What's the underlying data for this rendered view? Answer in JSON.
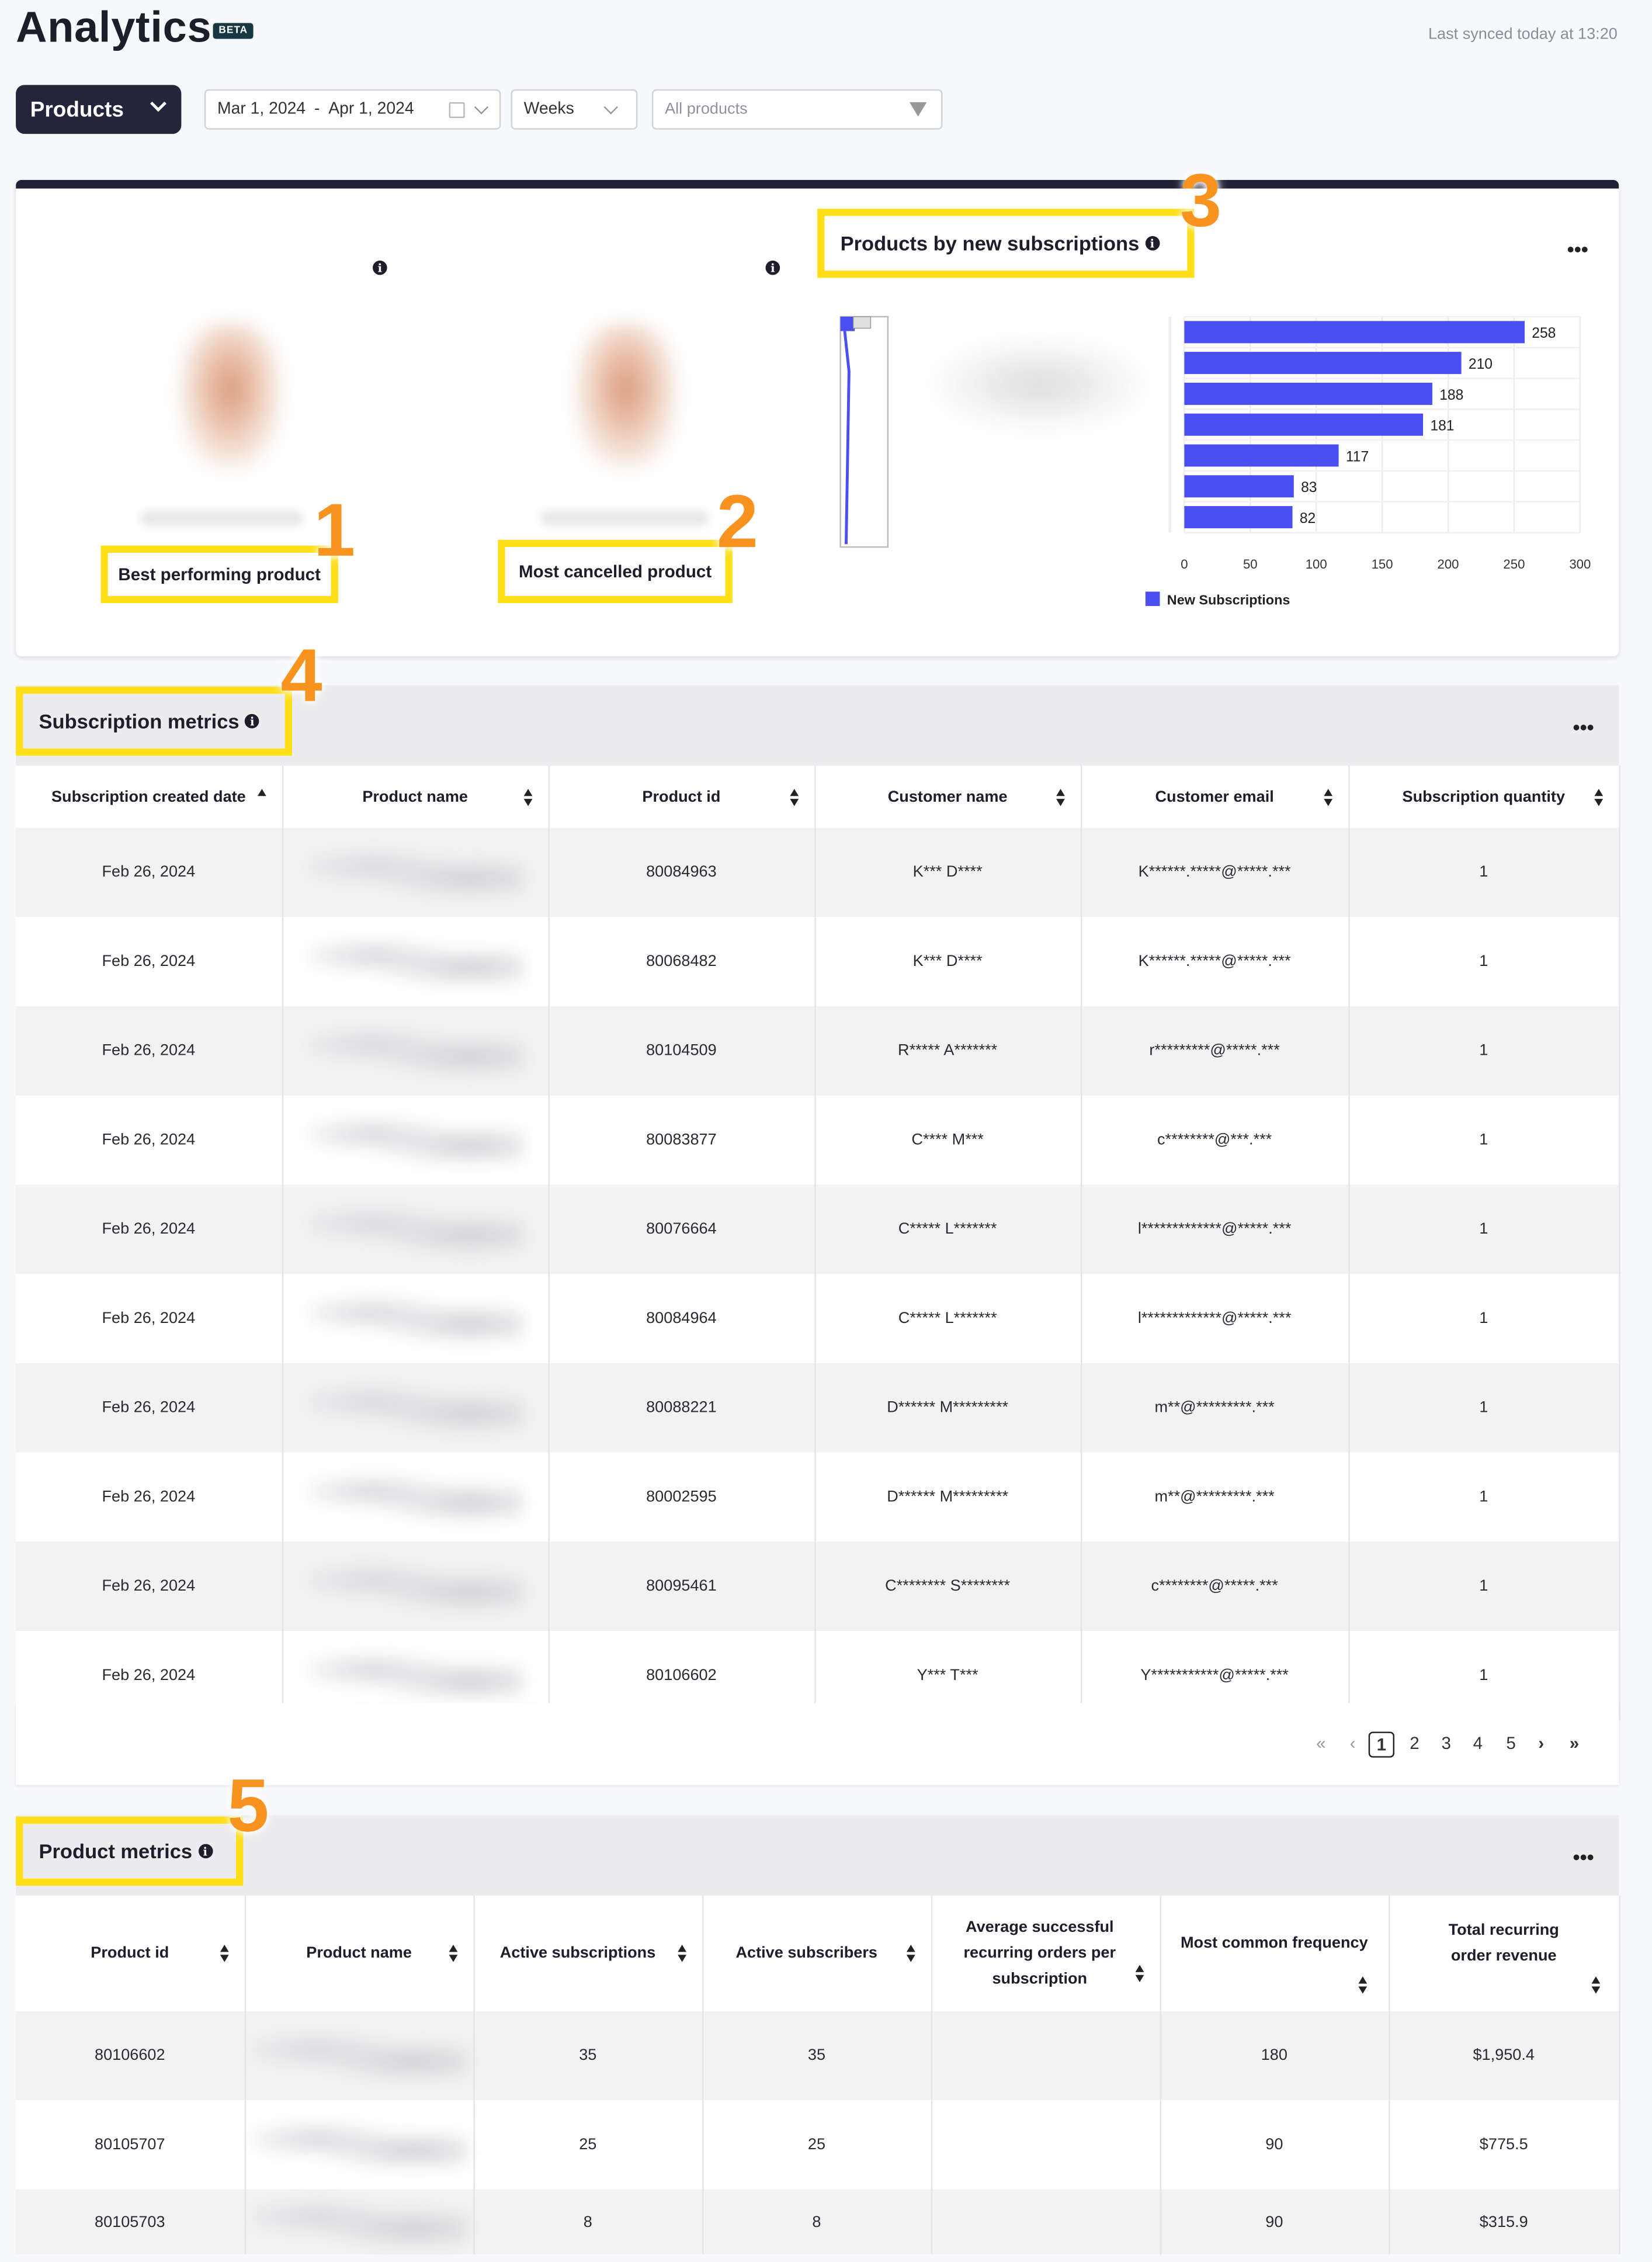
{
  "header": {
    "title": "Analytics",
    "badge": "BETA",
    "last_synced": "Last synced today at 13:20"
  },
  "filters": {
    "view_select": "Products",
    "date_start": "Mar 1, 2024",
    "date_separator": "-",
    "date_end": "Apr 1, 2024",
    "interval": "Weeks",
    "product_filter_placeholder": "All products"
  },
  "top_card": {
    "best_label": "Best performing product",
    "cancelled_label": "Most cancelled product",
    "chart_title": "Products by new subscriptions",
    "more": "•••",
    "annotations": [
      "1",
      "2",
      "3"
    ]
  },
  "chart_data": {
    "type": "bar",
    "orientation": "horizontal",
    "title": "Products by new subscriptions",
    "categories": [
      "",
      "",
      "",
      "",
      "",
      "",
      ""
    ],
    "series": [
      {
        "name": "New Subscriptions",
        "values": [
          258,
          210,
          188,
          181,
          117,
          83,
          82
        ],
        "color": "#4b4ef0"
      }
    ],
    "x_ticks": [
      "0",
      "50",
      "100",
      "150",
      "200",
      "250",
      "300"
    ],
    "xlim": [
      0,
      300
    ],
    "grid": true,
    "legend": "bottom"
  },
  "subscription_metrics": {
    "title": "Subscription metrics",
    "annotation": "4",
    "more": "•••",
    "columns": [
      "Subscription created date",
      "Product name",
      "Product id",
      "Customer name",
      "Customer email",
      "Subscription quantity"
    ],
    "rows": [
      [
        "Feb 26, 2024",
        "",
        "80084963",
        "K*** D****",
        "K******.*****@*****.***",
        "1"
      ],
      [
        "Feb 26, 2024",
        "",
        "80068482",
        "K*** D****",
        "K******.*****@*****.***",
        "1"
      ],
      [
        "Feb 26, 2024",
        "",
        "80104509",
        "R***** A*******",
        "r*********@*****.***",
        "1"
      ],
      [
        "Feb 26, 2024",
        "",
        "80083877",
        "C**** M***",
        "c********@***.***",
        "1"
      ],
      [
        "Feb 26, 2024",
        "",
        "80076664",
        "C***** L*******",
        "l*************@*****.***",
        "1"
      ],
      [
        "Feb 26, 2024",
        "",
        "80084964",
        "C***** L*******",
        "l*************@*****.***",
        "1"
      ],
      [
        "Feb 26, 2024",
        "",
        "80088221",
        "D****** M*********",
        "m**@*********.***",
        "1"
      ],
      [
        "Feb 26, 2024",
        "",
        "80002595",
        "D****** M*********",
        "m**@*********.***",
        "1"
      ],
      [
        "Feb 26, 2024",
        "",
        "80095461",
        "C******** S********",
        "c********@*****.***",
        "1"
      ],
      [
        "Feb 26, 2024",
        "",
        "80106602",
        "Y*** T***",
        "Y***********@*****.***",
        "1"
      ]
    ],
    "pagination": {
      "first": "«",
      "prev": "‹",
      "pages": [
        "1",
        "2",
        "3",
        "4",
        "5"
      ],
      "current": "1",
      "next": "›",
      "last": "»"
    }
  },
  "product_metrics": {
    "title": "Product metrics",
    "annotation": "5",
    "more": "•••",
    "columns": [
      "Product id",
      "Product name",
      "Active subscriptions",
      "Active subscribers",
      "Average successful recurring orders per subscription",
      "Most common frequency",
      "Total recurring order revenue"
    ],
    "rows": [
      [
        "80106602",
        "",
        "35",
        "35",
        "",
        "180",
        "$1,950.4"
      ],
      [
        "80105707",
        "",
        "25",
        "25",
        "",
        "90",
        "$775.5"
      ],
      [
        "80105703",
        "",
        "8",
        "8",
        "",
        "90",
        "$315.9"
      ]
    ]
  }
}
